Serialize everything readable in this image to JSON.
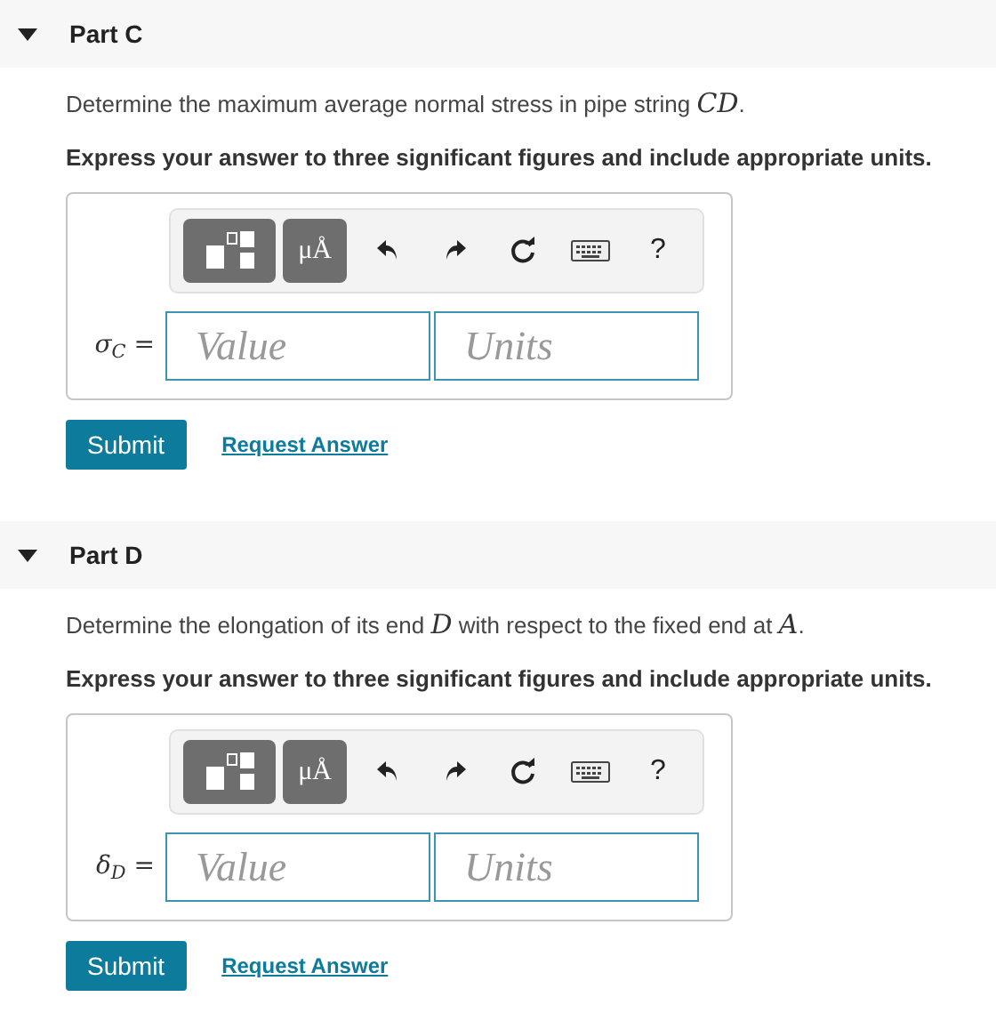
{
  "parts": [
    {
      "title": "Part C",
      "expanded": true,
      "question": "Determine the maximum average normal stress in pipe string *CD*.",
      "instruction": "Express your answer to three significant figures and include appropriate units.",
      "units_button": "μÅ",
      "help_button": "?",
      "variable": "σ$_{C}$ =",
      "value_field": {
        "placeholder": "Value"
      },
      "units_field": {
        "placeholder": "Units"
      },
      "submit": "Submit",
      "request_answer": "Request Answer"
    },
    {
      "title": "Part D",
      "expanded": true,
      "question": "Determine the elongation of its end *D* with respect to the fixed end at *A*.",
      "instruction": "Express your answer to three significant figures and include appropriate units.",
      "units_button": "μÅ",
      "help_button": "?",
      "variable": "δ$_{D}$ =",
      "value_field": {
        "placeholder": "Value"
      },
      "units_field": {
        "placeholder": "Units"
      },
      "submit": "Submit",
      "request_answer": "Request Answer"
    }
  ]
}
